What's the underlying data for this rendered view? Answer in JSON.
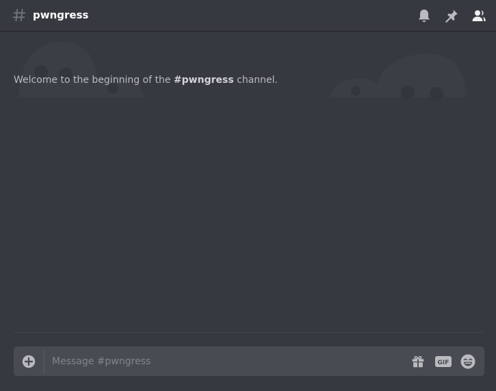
{
  "header": {
    "channel_name": "pwngress",
    "icons": [
      "hash-icon",
      "bell-icon",
      "pin-icon",
      "members-icon"
    ]
  },
  "messages": {
    "welcome_prefix": "Welcome to the beginning of the ",
    "welcome_channel": "#pwngress",
    "welcome_suffix": " channel."
  },
  "composer": {
    "placeholder": "Message #pwngress",
    "gif_label": "GIF",
    "icons": [
      "plus-circle-icon",
      "gift-icon",
      "gif-icon",
      "emoji-icon"
    ]
  },
  "colors": {
    "background": "#36393f",
    "composer": "#484c52",
    "header_text": "#ffffff",
    "muted_text": "#b9bbbe",
    "icon": "#b9bbbe"
  }
}
